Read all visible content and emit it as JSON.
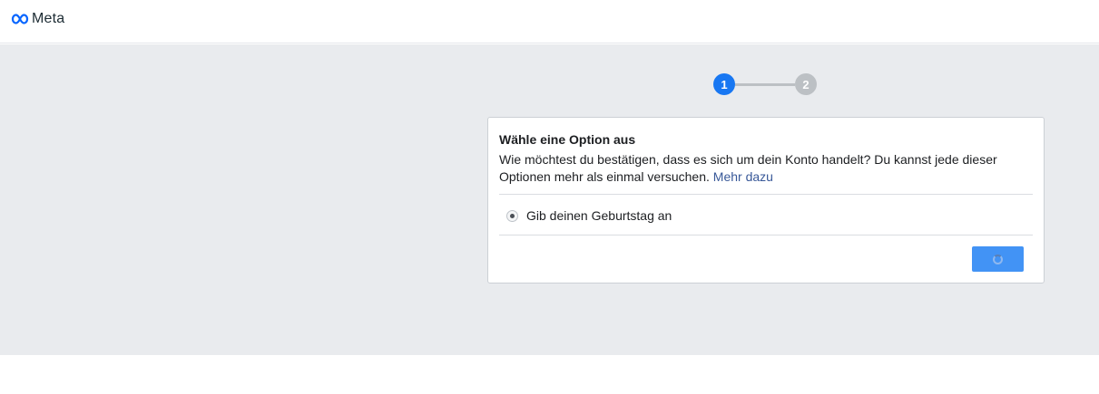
{
  "header": {
    "brand": "Meta"
  },
  "stepper": {
    "steps": [
      "1",
      "2"
    ],
    "current": 1
  },
  "card": {
    "title": "Wähle eine Option aus",
    "description": "Wie möchtest du bestätigen, dass es sich um dein Konto handelt? Du kannst jede dieser Optionen mehr als einmal versuchen.",
    "learn_more": "Mehr dazu",
    "options": [
      {
        "label": "Gib deinen Geburtstag an",
        "selected": true
      }
    ],
    "continue_button": {
      "state": "loading",
      "icon": "spinner-icon"
    }
  },
  "colors": {
    "accent": "#1877f2",
    "button": "#4293f5",
    "background": "#e9ebee"
  }
}
